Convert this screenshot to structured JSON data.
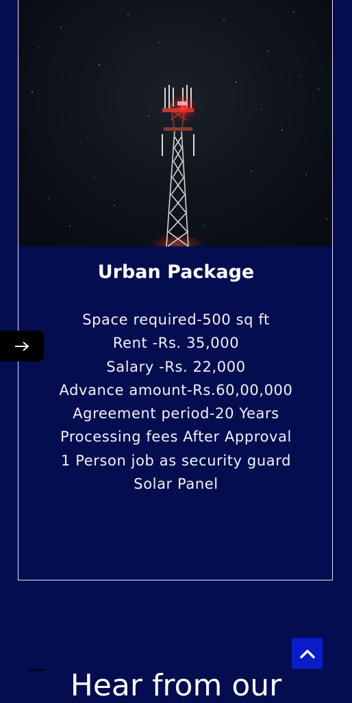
{
  "package": {
    "title": "Urban Package",
    "features": [
      "Space required-500 sq ft",
      "Rent -Rs. 35,000",
      "Salary -Rs. 22,000",
      "Advance amount-Rs.60,00,000",
      "Agreement period-20 Years",
      "Processing fees After Approval",
      "1 Person job as security guard",
      "Solar Panel"
    ]
  },
  "section": {
    "heading": "Hear from our"
  },
  "icons": {
    "side_arrow": "arrow-right-icon",
    "back_to_top": "chevron-up-icon"
  },
  "colors": {
    "background": "#030d4f",
    "card_border": "#e8ebf5",
    "back_to_top": "#0a1cc9",
    "side_tab": "#000000"
  }
}
